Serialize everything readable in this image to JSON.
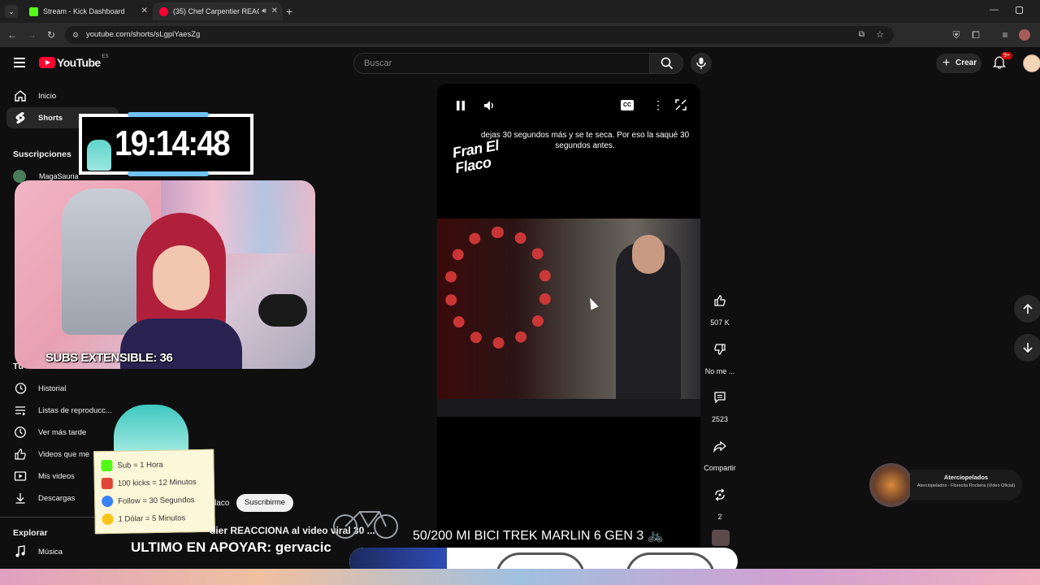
{
  "browser": {
    "tabs": [
      {
        "title": "Stream - Kick Dashboard",
        "favicon_color": "#53fc18"
      },
      {
        "title": "(35) Chef Carpentier REACCI",
        "favicon_color": "#ff0033"
      }
    ],
    "url": "youtube.com/shorts/sLgpiYaesZg"
  },
  "youtube": {
    "logo": "YouTube",
    "region": "ES",
    "search_placeholder": "Buscar",
    "create_label": "Crear",
    "notif_badge": "9+"
  },
  "sidebar": {
    "top": [
      {
        "label": "Inicio",
        "icon": "home-icon"
      },
      {
        "label": "Shorts",
        "icon": "shorts-icon"
      }
    ],
    "subscriptions_title": "Suscripciones",
    "subscription_first": "MagaSauria",
    "you_title": "Tú",
    "you_items": [
      {
        "label": "Historial",
        "icon": "history-icon"
      },
      {
        "label": "Listas de reproducc...",
        "icon": "playlist-icon"
      },
      {
        "label": "Ver más tarde",
        "icon": "watch-later-icon"
      },
      {
        "label": "Videos que me",
        "icon": "like-icon"
      },
      {
        "label": "Mis videos",
        "icon": "my-videos-icon"
      },
      {
        "label": "Descargas",
        "icon": "download-icon"
      }
    ],
    "explore_title": "Explorar",
    "explore_items": [
      {
        "label": "Música",
        "icon": "music-icon"
      }
    ]
  },
  "overlay": {
    "clock": "19:14:48",
    "subs_text": "SUBS EXTENSIBLE: 36",
    "rules": [
      {
        "text": "Sub = 1 Hora",
        "icon_color": "#53fc18"
      },
      {
        "text": "100 kicks = 12 Minutos",
        "icon_color": "#e0453a"
      },
      {
        "text": "Follow = 30 Segundos",
        "icon_color": "#3b82f6"
      },
      {
        "text": "1 Dólar = 5 Minutos",
        "icon_color": "#f5c518"
      }
    ],
    "goal_text": "50/200 MI BICI TREK MARLIN 6 GEN 3 🚲",
    "ticker_line1_fragment": "dier REACCIONA al video viral 30 ...",
    "ticker_channel_fragment": "laco",
    "subscribe_label": "Suscribirme",
    "last_supporter": "ULTIMO EN APOYAR: gervacic"
  },
  "player": {
    "subtitle": "dejas 30 segundos más y se te seca. Por eso la saqué 30 segundos antes.",
    "watermark": "Fran El Flaco",
    "cc_label": "CC"
  },
  "actions": {
    "likes": "507 K",
    "dislike": "No me ...",
    "comments": "2523",
    "share": "Compartir",
    "remix": "2"
  },
  "music_card": {
    "artist": "Aterciopelados",
    "song": "Aterciopelados - Florecita Rockera (Video Oficial)"
  }
}
